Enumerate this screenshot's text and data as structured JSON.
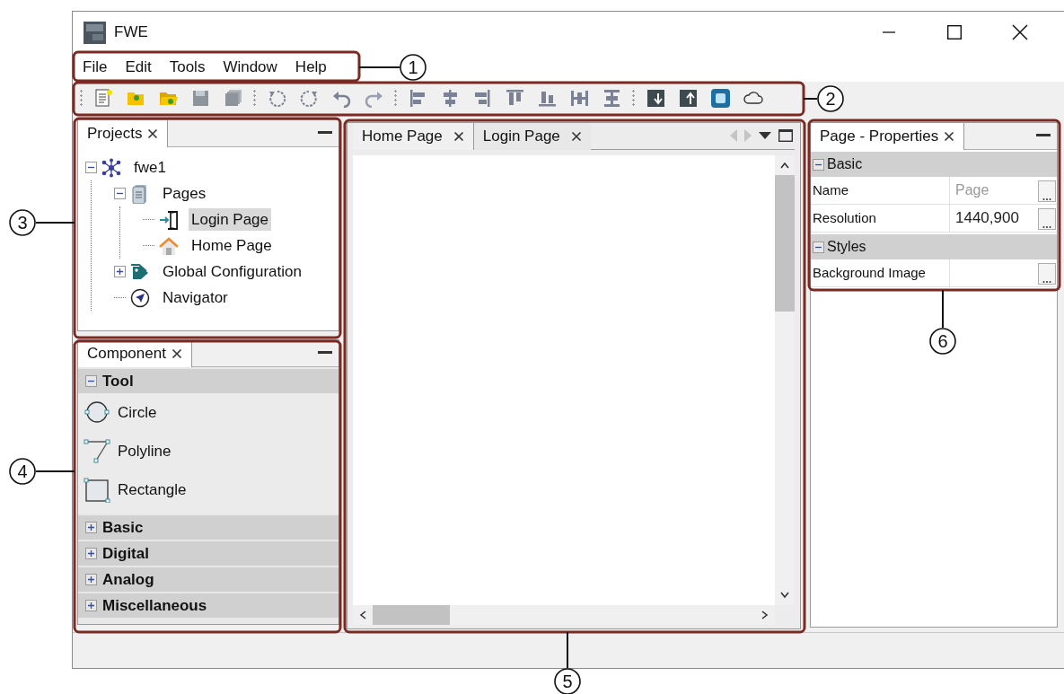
{
  "window": {
    "title": "FWE"
  },
  "menu": [
    "File",
    "Edit",
    "Tools",
    "Window",
    "Help"
  ],
  "projects_panel": {
    "tab": "Projects",
    "tree": [
      {
        "label": "fwe1",
        "kind": "project",
        "expanded": true,
        "selected": false,
        "children": [
          {
            "label": "Pages",
            "kind": "pages",
            "expanded": true,
            "selected": false,
            "children": [
              {
                "label": "Login Page",
                "kind": "login",
                "selected": true
              },
              {
                "label": "Home Page",
                "kind": "home",
                "selected": false
              }
            ]
          },
          {
            "label": "Global Configuration",
            "kind": "config",
            "expanded": false,
            "selected": false
          },
          {
            "label": "Navigator",
            "kind": "navigator",
            "selected": false
          }
        ]
      }
    ]
  },
  "component_panel": {
    "tab": "Component",
    "groups": [
      {
        "label": "Tool",
        "expanded": true,
        "items": [
          {
            "label": "Circle",
            "kind": "circle"
          },
          {
            "label": "Polyline",
            "kind": "polyline"
          },
          {
            "label": "Rectangle",
            "kind": "rectangle"
          }
        ]
      },
      {
        "label": "Basic",
        "expanded": false
      },
      {
        "label": "Digital",
        "expanded": false
      },
      {
        "label": "Analog",
        "expanded": false
      },
      {
        "label": "Miscellaneous",
        "expanded": false
      }
    ]
  },
  "editor": {
    "tabs": [
      {
        "label": "Home Page",
        "selected": true
      },
      {
        "label": "Login Page",
        "selected": false
      }
    ]
  },
  "properties_panel": {
    "tab": "Page - Properties",
    "sections": [
      {
        "label": "Basic",
        "expanded": true,
        "rows": [
          {
            "name": "Name",
            "placeholder": "Page"
          },
          {
            "name": "Resolution",
            "value": "1440,900"
          }
        ]
      },
      {
        "label": "Styles",
        "expanded": true,
        "rows": [
          {
            "name": "Background Image"
          }
        ]
      }
    ]
  },
  "callouts": [
    "1",
    "2",
    "3",
    "4",
    "5",
    "6"
  ]
}
